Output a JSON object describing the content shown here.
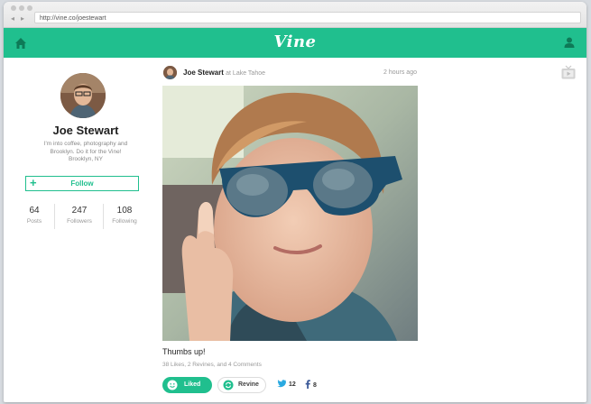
{
  "browser": {
    "url": "http://vine.co/joestewart",
    "back_icon": "◂",
    "forward_icon": "▸"
  },
  "topbar": {
    "logo": "Vine",
    "accent": "#20bf8e"
  },
  "profile": {
    "name": "Joe Stewart",
    "bio_line1": "I'm into coffee, photography and",
    "bio_line2": "Brooklyn. Do it for the Vine!",
    "location": "Brooklyn, NY",
    "follow_label": "Follow",
    "follow_icon": "+",
    "stats": [
      {
        "value": "64",
        "label": "Posts"
      },
      {
        "value": "247",
        "label": "Followers"
      },
      {
        "value": "108",
        "label": "Following"
      }
    ]
  },
  "post": {
    "author": "Joe Stewart",
    "location": "at Lake Tahoe",
    "time": "2 hours ago",
    "caption": "Thumbs up!",
    "meta": "38 Likes, 2 Revines, and 4 Comments",
    "liked_label": "Liked",
    "revine_label": "Revine",
    "twitter_count": "12",
    "facebook_count": "8"
  }
}
